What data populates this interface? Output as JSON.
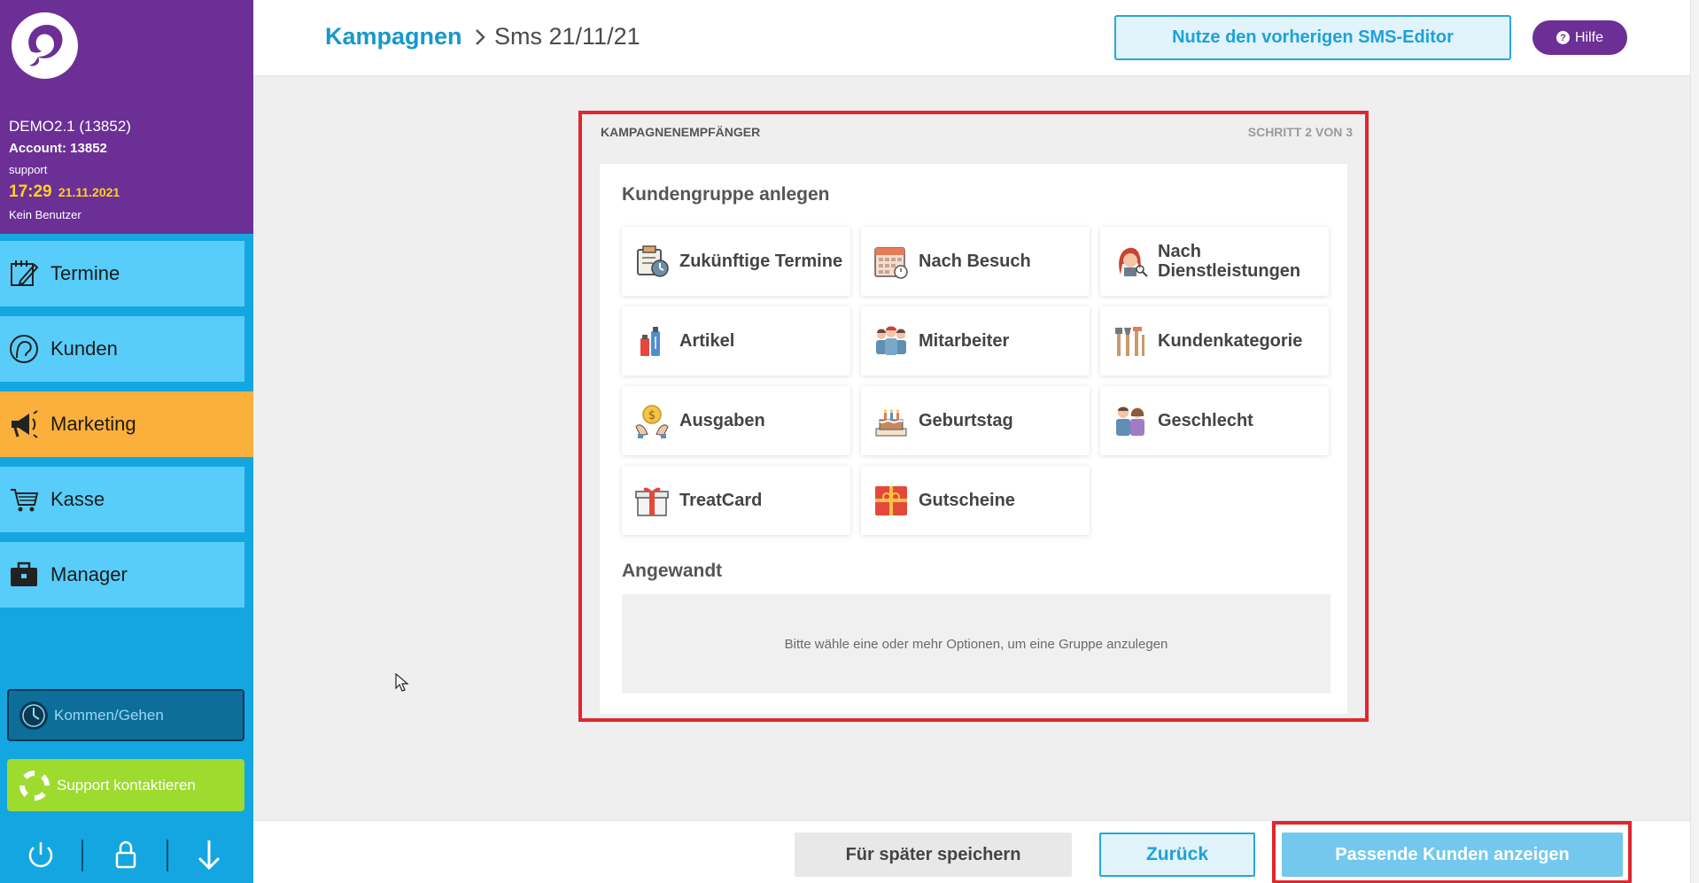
{
  "account": {
    "name": "DEMO2.1 (13852)",
    "account_line": "Account: 13852",
    "user": "support",
    "time": "17:29",
    "date": "21.11.2021",
    "no_user": "Kein Benutzer"
  },
  "sidebar": {
    "items": [
      {
        "label": "Termine",
        "icon": "calendar-edit-icon"
      },
      {
        "label": "Kunden",
        "icon": "customer-head-icon"
      },
      {
        "label": "Marketing",
        "icon": "megaphone-icon",
        "active": true
      },
      {
        "label": "Kasse",
        "icon": "cart-icon"
      },
      {
        "label": "Manager",
        "icon": "briefcase-icon"
      }
    ],
    "clock_button": "Kommen/Gehen",
    "support_button": "Support kontaktieren",
    "bottom_icons": [
      "power-icon",
      "lock-icon",
      "arrow-down-icon"
    ]
  },
  "header": {
    "breadcrumb_root": "Kampagnen",
    "breadcrumb_current": "Sms 21/11/21",
    "prev_editor_button": "Nutze den vorherigen SMS-Editor",
    "help_button": "Hilfe"
  },
  "panel": {
    "title": "KAMPAGNENEMPFÄNGER",
    "step": "SCHRITT 2 VON 3",
    "group_heading": "Kundengruppe anlegen",
    "tiles": [
      {
        "label": "Zukünftige Termine",
        "icon": "future-appointments-icon"
      },
      {
        "label": "Nach Besuch",
        "icon": "calendar-visit-icon"
      },
      {
        "label": "Nach Dienstleistungen",
        "icon": "services-icon"
      },
      {
        "label": "Artikel",
        "icon": "product-bottles-icon"
      },
      {
        "label": "Mitarbeiter",
        "icon": "staff-group-icon"
      },
      {
        "label": "Kundenkategorie",
        "icon": "category-tools-icon"
      },
      {
        "label": "Ausgaben",
        "icon": "money-hands-icon"
      },
      {
        "label": "Geburtstag",
        "icon": "birthday-cake-icon"
      },
      {
        "label": "Geschlecht",
        "icon": "gender-icon"
      },
      {
        "label": "TreatCard",
        "icon": "gift-card-icon"
      },
      {
        "label": "Gutscheine",
        "icon": "voucher-icon"
      }
    ],
    "applied_heading": "Angewandt",
    "applied_placeholder": "Bitte wähle eine oder mehr Optionen, um eine Gruppe anzulegen"
  },
  "footer": {
    "save_later": "Für später speichern",
    "back": "Zurück",
    "show_customers": "Passende Kunden anzeigen"
  },
  "colors": {
    "sidebar_purple": "#6b2f96",
    "sidebar_blue": "#14a6e1",
    "nav_item": "#58cdfa",
    "nav_active": "#fbb03b",
    "accent_blue": "#1da2d8",
    "highlight_red": "#e0262e",
    "support_green": "#9ddb2e"
  }
}
